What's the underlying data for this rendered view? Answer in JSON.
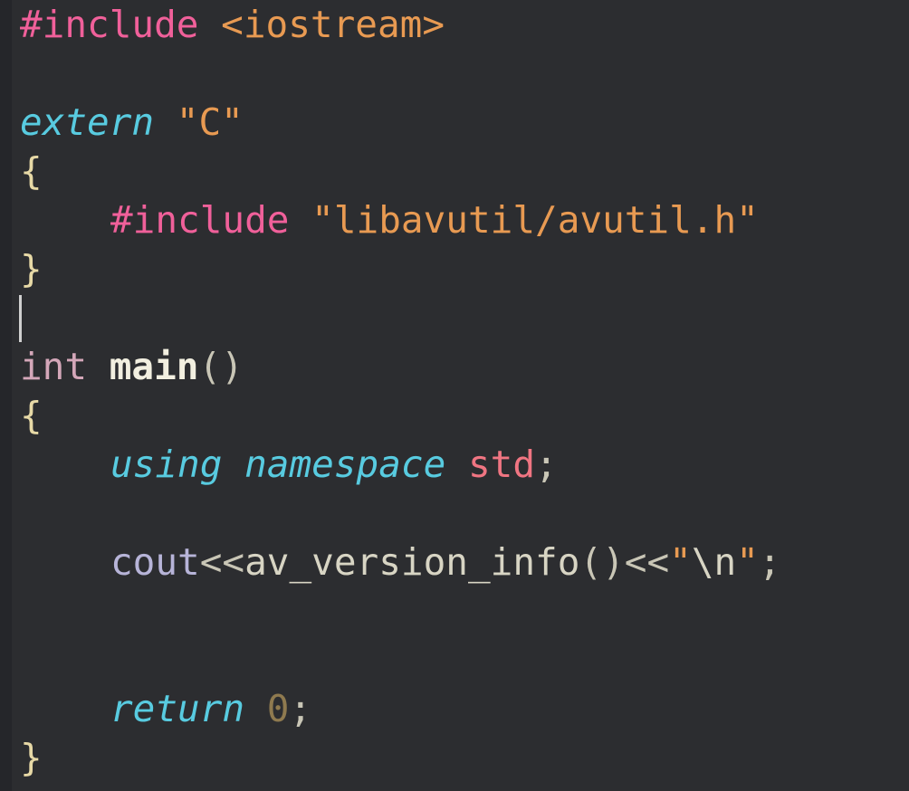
{
  "editor": {
    "lines": {
      "l1": {
        "directive": "#include",
        "header": "<iostream>"
      },
      "l3": {
        "keyword": "extern",
        "string": "\"C\""
      },
      "l4": {
        "brace": "{"
      },
      "l5": {
        "directive": "#include",
        "string": "\"libavutil/avutil.h\""
      },
      "l6": {
        "brace": "}"
      },
      "l8": {
        "type": "int",
        "function": "main",
        "parens": "()"
      },
      "l9": {
        "brace": "{"
      },
      "l10": {
        "kw1": "using",
        "kw2": "namespace",
        "ns": "std",
        "semi": ";"
      },
      "l12": {
        "object": "cout",
        "op1": "<<",
        "call": "av_version_info",
        "parens": "()",
        "op2": "<<",
        "q1": "\"",
        "escape": "\\n",
        "q2": "\"",
        "semi": ";"
      },
      "l15": {
        "keyword": "return",
        "number": "0",
        "semi": ";"
      },
      "l16": {
        "brace": "}"
      }
    }
  },
  "colors": {
    "background": "#2c2d30",
    "directive": "#f0609a",
    "string": "#e89a52",
    "keyword": "#58cbe0",
    "namespace": "#f07582"
  }
}
